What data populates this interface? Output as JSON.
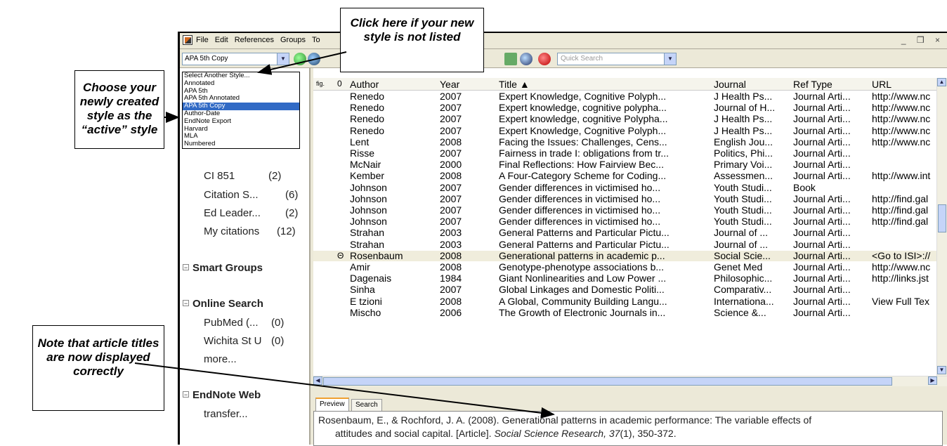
{
  "callouts": {
    "top": "Click here if your new style is not listed",
    "left": "Choose your newly created style as the “active” style",
    "bottom": "Note that article titles are now displayed correctly"
  },
  "menu": [
    "File",
    "Edit",
    "References",
    "Groups",
    "To"
  ],
  "window_controls": "_ ❒ ×",
  "toolbar": {
    "style_value": "APA 5th Copy",
    "quick_search_placeholder": "Quick Search"
  },
  "style_list": {
    "items": [
      "Select Another Style...",
      "Annotated",
      "APA 5th",
      "APA 5th Annotated",
      "APA 5th Copy",
      "Author-Date",
      "EndNote Export",
      "Harvard",
      "MLA",
      "Numbered"
    ],
    "selected": "APA 5th Copy"
  },
  "groups": {
    "items": [
      {
        "label": "CI 851",
        "count": "(2)"
      },
      {
        "label": "Citation S...",
        "count": "(6)"
      },
      {
        "label": "Ed Leader...",
        "count": "(2)"
      },
      {
        "label": "My citations",
        "count": "(12)"
      }
    ],
    "smart_groups": "Smart Groups",
    "online_search": "Online Search",
    "online_items": [
      {
        "label": "PubMed (...",
        "count": "(0)"
      },
      {
        "label": "Wichita St U",
        "count": "(0)"
      },
      {
        "label": "more...",
        "count": ""
      }
    ],
    "endnote_web": "EndNote Web",
    "endnote_web_item": "transfer..."
  },
  "table": {
    "headers": {
      "author": "Author",
      "year": "Year",
      "title": "Title ▲",
      "journal": "Journal",
      "ref_type": "Ref Type",
      "url": "URL"
    },
    "rows": [
      {
        "att": "",
        "author": "Renedo",
        "year": "2007",
        "title": "Expert Knowledge, Cognitive Polyph...",
        "journal": "J Health Ps...",
        "type": "Journal Arti...",
        "url": "http://www.nc"
      },
      {
        "att": "",
        "author": "Renedo",
        "year": "2007",
        "title": "Expert knowledge, cognitive polypha...",
        "journal": "Journal of H...",
        "type": "Journal Arti...",
        "url": "http://www.nc"
      },
      {
        "att": "",
        "author": "Renedo",
        "year": "2007",
        "title": "Expert knowledge, cognitive Polypha...",
        "journal": "J Health Ps...",
        "type": "Journal Arti...",
        "url": "http://www.nc"
      },
      {
        "att": "",
        "author": "Renedo",
        "year": "2007",
        "title": "Expert Knowledge, Cognitive Polyph...",
        "journal": "J Health Ps...",
        "type": "Journal Arti...",
        "url": "http://www.nc"
      },
      {
        "att": "",
        "author": "Lent",
        "year": "2008",
        "title": "Facing the Issues: Challenges, Cens...",
        "journal": "English Jou...",
        "type": "Journal Arti...",
        "url": "http://www.nc"
      },
      {
        "att": "",
        "author": "Risse",
        "year": "2007",
        "title": "Fairness in trade I: obligations from tr...",
        "journal": "Politics, Phi...",
        "type": "Journal Arti...",
        "url": ""
      },
      {
        "att": "",
        "author": "McNair",
        "year": "2000",
        "title": "Final Reflections: How Fairview Bec...",
        "journal": "Primary Voi...",
        "type": "Journal Arti...",
        "url": ""
      },
      {
        "att": "",
        "author": "Kember",
        "year": "2008",
        "title": "A Four-Category Scheme for Coding...",
        "journal": "Assessmen...",
        "type": "Journal Arti...",
        "url": "http://www.int"
      },
      {
        "att": "",
        "author": "Johnson",
        "year": "2007",
        "title": "Gender differences in victimised ho...",
        "journal": "Youth Studi...",
        "type": "Book",
        "url": ""
      },
      {
        "att": "",
        "author": "Johnson",
        "year": "2007",
        "title": "Gender differences in victimised ho...",
        "journal": "Youth Studi...",
        "type": "Journal Arti...",
        "url": "http://find.gal"
      },
      {
        "att": "",
        "author": "Johnson",
        "year": "2007",
        "title": "Gender differences in victimised ho...",
        "journal": "Youth Studi...",
        "type": "Journal Arti...",
        "url": "http://find.gal"
      },
      {
        "att": "",
        "author": "Johnson",
        "year": "2007",
        "title": "Gender differences in victimised ho...",
        "journal": "Youth Studi...",
        "type": "Journal Arti...",
        "url": "http://find.gal"
      },
      {
        "att": "",
        "author": "Strahan",
        "year": "2003",
        "title": "General Patterns and Particular Pictu...",
        "journal": "Journal of ...",
        "type": "Journal Arti...",
        "url": ""
      },
      {
        "att": "",
        "author": "Strahan",
        "year": "2003",
        "title": "General Patterns and Particular Pictu...",
        "journal": "Journal of ...",
        "type": "Journal Arti...",
        "url": ""
      },
      {
        "att": "Θ",
        "author": "Rosenbaum",
        "year": "2008",
        "title": "Generational patterns in academic p...",
        "journal": "Social Scie...",
        "type": "Journal Arti...",
        "url": "<Go to ISI>://"
      },
      {
        "att": "",
        "author": "Amir",
        "year": "2008",
        "title": "Genotype-phenotype associations b...",
        "journal": "Genet Med",
        "type": "Journal Arti...",
        "url": "http://www.nc"
      },
      {
        "att": "",
        "author": "Dagenais",
        "year": "1984",
        "title": "Giant Nonlinearities and Low Power ...",
        "journal": "Philosophic...",
        "type": "Journal Arti...",
        "url": "http://links.jst"
      },
      {
        "att": "",
        "author": "Sinha",
        "year": "2007",
        "title": "Global Linkages and Domestic Politi...",
        "journal": "Comparativ...",
        "type": "Journal Arti...",
        "url": ""
      },
      {
        "att": "",
        "author": "E tzioni",
        "year": "2008",
        "title": "A Global, Community Building Langu...",
        "journal": "Internationa...",
        "type": "Journal Arti...",
        "url": "View Full Tex"
      },
      {
        "att": "",
        "author": "Mischo",
        "year": "2006",
        "title": "The Growth of Electronic Journals in...",
        "journal": "Science &...",
        "type": "Journal Arti...",
        "url": ""
      }
    ],
    "highlighted_row": 14
  },
  "preview": {
    "tab_preview": "Preview",
    "tab_search": "Search",
    "line1": "Rosenbaum, E., & Rochford, J. A. (2008). Generational patterns in academic performance: The variable effects of",
    "line2_plain": "attitudes and social capital. [Article]. ",
    "line2_journal": "Social Science Research, 37",
    "line2_rest": "(1), 350-372."
  }
}
